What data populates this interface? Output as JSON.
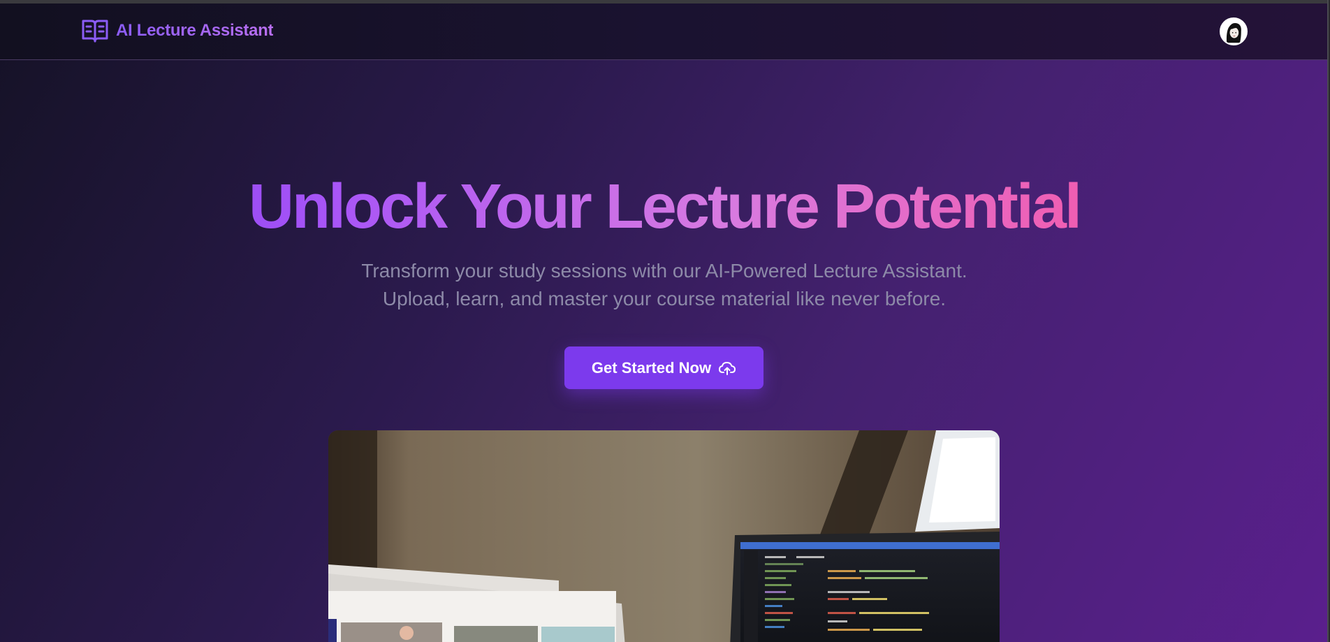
{
  "navbar": {
    "brand_name": "AI Lecture Assistant",
    "brand_icon": "open-book-icon",
    "avatar_icon": "user-avatar-icon"
  },
  "hero": {
    "title": "Unlock Your Lecture Potential",
    "subtitle_line1": "Transform your study sessions with our AI-Powered Lecture Assistant.",
    "subtitle_line2": "Upload, learn, and master your course material like never before.",
    "cta_label": "Get Started Now",
    "cta_icon": "cloud-upload-icon",
    "image": "laptops-photo"
  },
  "colors": {
    "accent": "#7c3aed",
    "title_gradient_start": "#7c3aed",
    "title_gradient_end": "#ec4899",
    "subtitle": "#8d8aa8"
  }
}
